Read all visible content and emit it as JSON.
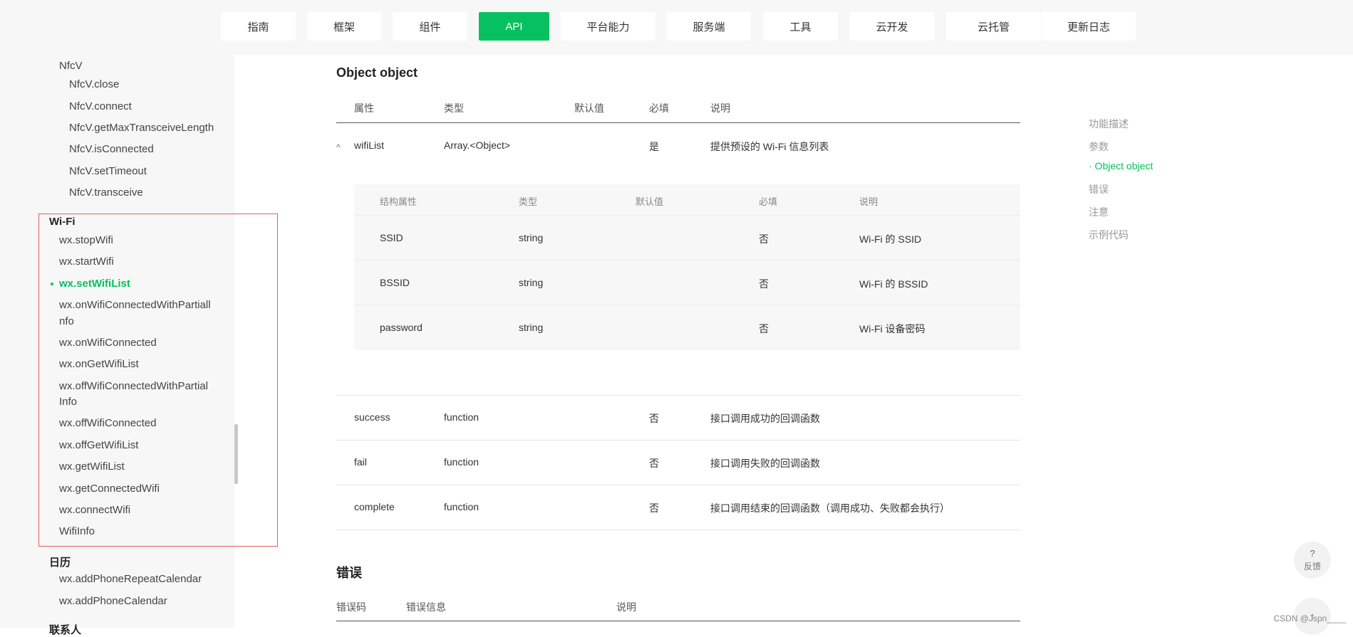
{
  "nav": [
    "指南",
    "框架",
    "组件",
    "API",
    "平台能力",
    "服务端",
    "工具",
    "云开发",
    "云托管",
    "更新日志"
  ],
  "nav_active": "API",
  "sidebar": {
    "nfcv_group": "NfcV",
    "nfcv_items": [
      "NfcV.close",
      "NfcV.connect",
      "NfcV.getMaxTransceiveLength",
      "NfcV.isConnected",
      "NfcV.setTimeout",
      "NfcV.transceive"
    ],
    "wifi_group": "Wi-Fi",
    "wifi_items": [
      "wx.stopWifi",
      "wx.startWifi",
      "wx.setWifiList",
      "wx.onWifiConnectedWithPartiall",
      "nfo",
      "wx.onWifiConnected",
      "wx.onGetWifiList",
      "wx.offWifiConnectedWithPartial",
      "Info",
      "wx.offWifiConnected",
      "wx.offGetWifiList",
      "wx.getWifiList",
      "wx.getConnectedWifi",
      "wx.connectWifi",
      "WifiInfo"
    ],
    "calendar_group": "日历",
    "calendar_items": [
      "wx.addPhoneRepeatCalendar",
      "wx.addPhoneCalendar"
    ],
    "contacts_group": "联系人"
  },
  "main": {
    "section_title": "Object object",
    "headers": [
      "属性",
      "类型",
      "默认值",
      "必填",
      "说明"
    ],
    "wifiList": {
      "name": "wifiList",
      "type": "Array.<Object>",
      "required": "是",
      "desc": "提供预设的 Wi-Fi 信息列表"
    },
    "sub_headers": [
      "结构属性",
      "类型",
      "默认值",
      "必填",
      "说明"
    ],
    "sub_rows": [
      {
        "name": "SSID",
        "type": "string",
        "required": "否",
        "desc": "Wi-Fi 的 SSID"
      },
      {
        "name": "BSSID",
        "type": "string",
        "required": "否",
        "desc": "Wi-Fi 的 BSSID"
      },
      {
        "name": "password",
        "type": "string",
        "required": "否",
        "desc": "Wi-Fi 设备密码"
      }
    ],
    "rows": [
      {
        "name": "success",
        "type": "function",
        "required": "否",
        "desc": "接口调用成功的回调函数"
      },
      {
        "name": "fail",
        "type": "function",
        "required": "否",
        "desc": "接口调用失败的回调函数"
      },
      {
        "name": "complete",
        "type": "function",
        "required": "否",
        "desc": "接口调用结束的回调函数（调用成功、失败都会执行）"
      }
    ],
    "error_title": "错误",
    "error_headers": [
      "错误码",
      "错误信息",
      "说明"
    ]
  },
  "toc": [
    "功能描述",
    "参数",
    "· Object object",
    "错误",
    "注意",
    "示例代码"
  ],
  "toc_active": "· Object object",
  "feedback": {
    "icon": "?",
    "label": "反馈"
  },
  "watermark": "CSDN @Jspn____",
  "colors": {
    "accent": "#07c160",
    "highlight_border": "#e85a5a"
  }
}
